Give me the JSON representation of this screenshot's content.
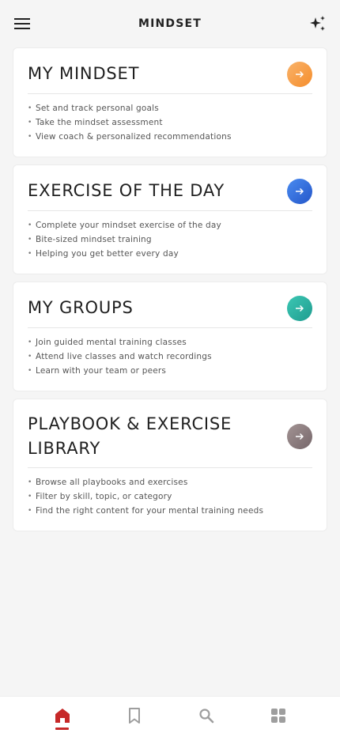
{
  "header": {
    "title": "MINDSET",
    "menu_icon": "menu-icon",
    "action_icon": "sparkle-icon"
  },
  "cards": [
    {
      "title": "MY MINDSET",
      "arrow_color": "#f7a24b",
      "items": [
        "Set and track personal goals",
        "Take the mindset assessment",
        "View coach & personalized recommendations"
      ]
    },
    {
      "title": "EXERCISE OF THE DAY",
      "arrow_color": "#2f6fdc",
      "items": [
        "Complete your mindset exercise of the day",
        "Bite-sized mindset training",
        "Helping you get better every day"
      ]
    },
    {
      "title": "MY GROUPS",
      "arrow_color": "#2bb3a3",
      "items": [
        "Join guided mental training classes",
        "Attend live classes and watch recordings",
        "Learn with your team or peers"
      ]
    },
    {
      "title": "PLAYBOOK & EXERCISE LIBRARY",
      "arrow_color": "#8c7c7c",
      "items": [
        "Browse all playbooks and exercises",
        "Filter by skill, topic, or category",
        "Find the right content for your mental training needs"
      ]
    }
  ],
  "bottom_nav": {
    "items": [
      "home-icon",
      "bookmark-icon",
      "search-icon",
      "grid-icon"
    ],
    "active": "home-icon",
    "active_color": "#c62828",
    "inactive_color": "#9e9e9e"
  }
}
